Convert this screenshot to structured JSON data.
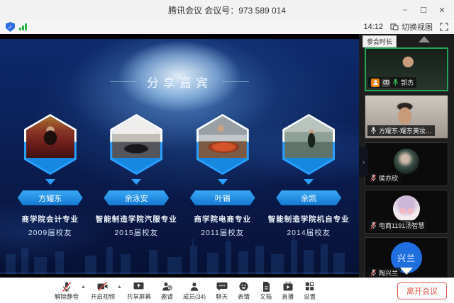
{
  "window": {
    "title": "腾讯会议 会议号：973 589 014",
    "controls": {
      "minimize": "–",
      "maximize": "☐",
      "close": "✕"
    }
  },
  "statusbar": {
    "time": "14:12",
    "switch_view_label": "切换视图"
  },
  "slide": {
    "title": "分享嘉宾",
    "guests": [
      {
        "name": "方耀东",
        "line1": "商学院会计专业",
        "line2": "2009届校友"
      },
      {
        "name": "余泳安",
        "line1": "智能制造学院汽服专业",
        "line2": "2015届校友"
      },
      {
        "name": "叶锡",
        "line1": "商学院电商专业",
        "line2": "2011届校友"
      },
      {
        "name": "余凯",
        "line1": "智能制造学院机自专业",
        "line2": "2014届校友"
      }
    ]
  },
  "sidebar": {
    "duration_tooltip": "参会时长",
    "participants": [
      {
        "name": "郭杰",
        "mic": "on",
        "host": true,
        "sharing": true,
        "active": true
      },
      {
        "name": "方耀东-耀东美妆…",
        "mic": "on",
        "host": false,
        "sharing": false,
        "active": false
      },
      {
        "name": "侯亦欣",
        "mic": "muted",
        "host": false,
        "sharing": false,
        "active": false
      },
      {
        "name": "电商1191汤智慧",
        "mic": "muted",
        "host": false,
        "sharing": false,
        "active": false
      },
      {
        "name": "陶兴兰",
        "mic": "muted",
        "host": false,
        "sharing": false,
        "active": false,
        "avatar_text": "兴兰"
      }
    ]
  },
  "toolbar": {
    "items": [
      {
        "label": "解除静音"
      },
      {
        "label": "开启视频"
      },
      {
        "label": "共享屏幕"
      },
      {
        "label": "邀请"
      },
      {
        "label": "成员(34)"
      },
      {
        "label": "聊天"
      },
      {
        "label": "表情"
      },
      {
        "label": "文档"
      },
      {
        "label": "直播"
      },
      {
        "label": "设置"
      }
    ],
    "leave_label": "离开会议"
  },
  "colors": {
    "accent_blue": "#2aa0ff",
    "active_green": "#23a455",
    "mic_green": "#35c24d",
    "mute_red": "#e04040",
    "host_orange": "#f08419",
    "leave_red": "#e0564a",
    "slide_navy": "#0b1f55"
  }
}
